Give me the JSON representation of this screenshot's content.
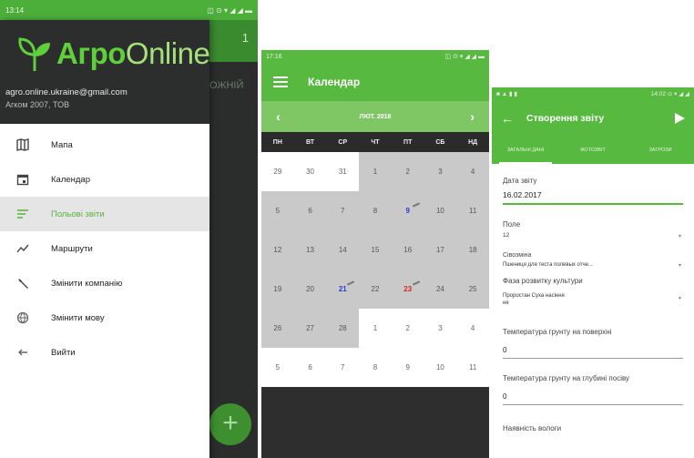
{
  "colors": {
    "brand_green": "#57b940",
    "month_bar_green": "#7fc764",
    "drawer_header": "#2b2e2c",
    "active_item_text": "#58b33e",
    "weekend_highlight_blue": "#2d3ad0",
    "weekend_highlight_red": "#d42424"
  },
  "drawer_screen": {
    "status_left": "13:14",
    "status_right": "◫ ⊙ ▾ ◢ ◢ ▬",
    "background_title_digit": "1",
    "background_label": "ОЖНІЙ",
    "fab_icon": "plus-icon",
    "logo": {
      "part1": "Агро",
      "part2": "Online"
    },
    "email": "agro.online.ukraine@gmail.com",
    "copyright": "Агком 2007, ТОВ",
    "menu": [
      {
        "label": "Мапа",
        "icon": "map-icon"
      },
      {
        "label": "Календар",
        "icon": "calendar-icon"
      },
      {
        "label": "Польові звіти",
        "icon": "reports-icon",
        "active": true
      },
      {
        "label": "Маршрути",
        "icon": "route-icon"
      },
      {
        "label": "Змінити компанію",
        "icon": "wrench-icon"
      },
      {
        "label": "Змінити мову",
        "icon": "globe-icon"
      },
      {
        "label": "Вийти",
        "icon": "exit-icon"
      }
    ]
  },
  "calendar_screen": {
    "status_left": "17:16",
    "status_right": "◫ ⊙ ▾ ◢ ◢ ▬",
    "title": "Календар",
    "menu_icon": "hamburger-icon",
    "month": "ЛЮТ. 2018",
    "prev": "‹",
    "next": "›",
    "weekdays": [
      "ПН",
      "ВТ",
      "СР",
      "ЧТ",
      "ПТ",
      "СБ",
      "НД"
    ],
    "weeks": [
      [
        {
          "d": "29",
          "out": true
        },
        {
          "d": "30",
          "out": true
        },
        {
          "d": "31",
          "out": true
        },
        {
          "d": "1"
        },
        {
          "d": "2"
        },
        {
          "d": "3"
        },
        {
          "d": "4"
        }
      ],
      [
        {
          "d": "5"
        },
        {
          "d": "6"
        },
        {
          "d": "7"
        },
        {
          "d": "8"
        },
        {
          "d": "9",
          "mark": "blue"
        },
        {
          "d": "10"
        },
        {
          "d": "11"
        }
      ],
      [
        {
          "d": "12"
        },
        {
          "d": "13"
        },
        {
          "d": "14"
        },
        {
          "d": "15"
        },
        {
          "d": "16"
        },
        {
          "d": "17"
        },
        {
          "d": "18"
        }
      ],
      [
        {
          "d": "19"
        },
        {
          "d": "20"
        },
        {
          "d": "21",
          "mark": "blue"
        },
        {
          "d": "22"
        },
        {
          "d": "23",
          "mark": "red"
        },
        {
          "d": "24"
        },
        {
          "d": "25"
        }
      ],
      [
        {
          "d": "26"
        },
        {
          "d": "27"
        },
        {
          "d": "28"
        },
        {
          "d": "1",
          "out": true
        },
        {
          "d": "2",
          "out": true
        },
        {
          "d": "3",
          "out": true
        },
        {
          "d": "4",
          "out": true
        }
      ],
      [
        {
          "d": "5",
          "out": true
        },
        {
          "d": "6",
          "out": true
        },
        {
          "d": "7",
          "out": true
        },
        {
          "d": "8",
          "out": true
        },
        {
          "d": "9",
          "out": true
        },
        {
          "d": "10",
          "out": true
        },
        {
          "d": "11",
          "out": true
        }
      ]
    ]
  },
  "report_screen": {
    "status_left": "■ ▲ ▮ ▮",
    "status_right": "14:02 ⊙ ▾ ◢ ◢",
    "back_icon": "←",
    "title": "Створення звіту",
    "send_icon": "send-icon",
    "tabs": [
      {
        "label": "ЗАГАЛЬНІ ДАНІ",
        "active": true
      },
      {
        "label": "ФОТОЗВІТ"
      },
      {
        "label": "ЗАГРОЗИ"
      }
    ],
    "fields": {
      "date_label": "Дата звіту",
      "date_value": "16.02.2017",
      "field_label": "Поле",
      "field_value": "12",
      "crop_label": "Сівозміна",
      "crop_value": "Пшениця для теста полевых отче...",
      "phase_label": "Фаза розвитку культури",
      "phase_value": "Проростан  Суха насіння",
      "phase_value_2": "ня",
      "temp_surface_label": "Температура грунту на поверхні",
      "temp_surface_value": "0",
      "temp_depth_label": "Температура грунту на глубині посіву",
      "temp_depth_value": "0",
      "cut_label": "Наявність вологи"
    },
    "dropdown_glyph": "▾"
  }
}
